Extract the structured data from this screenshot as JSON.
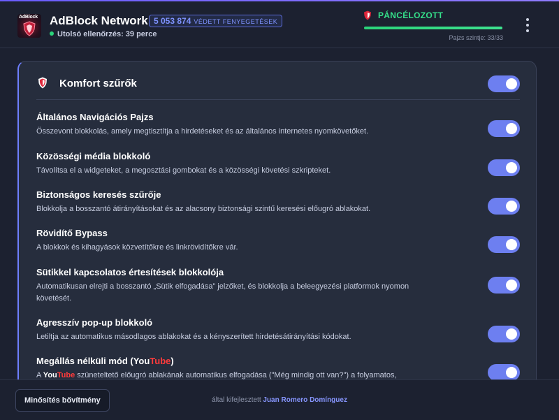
{
  "header": {
    "brand": "AdBlock Network",
    "logo_text": "AdBlock",
    "threat_count": "5 053 874",
    "threat_label": "VÉDETT FENYEGETÉSEK",
    "last_check": "Utolsó ellenőrzés: 39 perce",
    "armor_status": "PÁNCÉLOZOTT",
    "shield_level_text": "Pajzs szintje: 33/33",
    "shield_level_fraction": 1.0
  },
  "card": {
    "title": "Komfort szűrők",
    "master_enabled": true,
    "items": [
      {
        "title": "Általános Navigációs Pajzs",
        "desc": "Összevont blokkolás, amely megtisztítja a hirdetéseket és az általános internetes nyomkövetőket.",
        "enabled": true
      },
      {
        "title": "Közösségi média blokkoló",
        "desc": "Távolítsa el a widgeteket, a megosztási gombokat és a közösségi követési szkripteket.",
        "enabled": true
      },
      {
        "title": "Biztonságos keresés szűrője",
        "desc": "Blokkolja a bosszantó átirányításokat és az alacsony biztonsági szintű keresési előugró ablakokat.",
        "enabled": true
      },
      {
        "title": "Rövidítő Bypass",
        "desc": "A blokkok és kihagyások közvetítőkre és linkrövidítőkre vár.",
        "enabled": true
      },
      {
        "title": "Sütikkel kapcsolatos értesítések blokkolója",
        "desc": "Automatikusan elrejti a bosszantó „Sütik elfogadása” jelzőket, és blokkolja a beleegyezési platformok nyomon követését.",
        "enabled": true
      },
      {
        "title": "Agresszív pop-up blokkoló",
        "desc": "Letiltja az automatikus másodlagos ablakokat és a kényszerített hirdetésátirányítási kódokat.",
        "enabled": true
      },
      {
        "title_prefix": "Megállás nélküli mód (You",
        "title_yt": "Tube",
        "title_suffix": ")",
        "desc_prefix": "A ",
        "desc_you": "You",
        "desc_tube": "Tube",
        "desc_rest": " szüneteltető előugró ablakának automatikus elfogadása (\"Még mindig ott van?\") a folyamatos,",
        "enabled": true
      }
    ]
  },
  "footer": {
    "rate_button": "Minősítés bővítmény",
    "credit_prefix": "által kifejlesztett",
    "author": "Juan Romero Domínguez"
  },
  "colors": {
    "accent": "#6d7ff0",
    "armor_green": "#35e08a",
    "youtube_red": "#ff3b3b",
    "shield_red": "#e0263a"
  }
}
